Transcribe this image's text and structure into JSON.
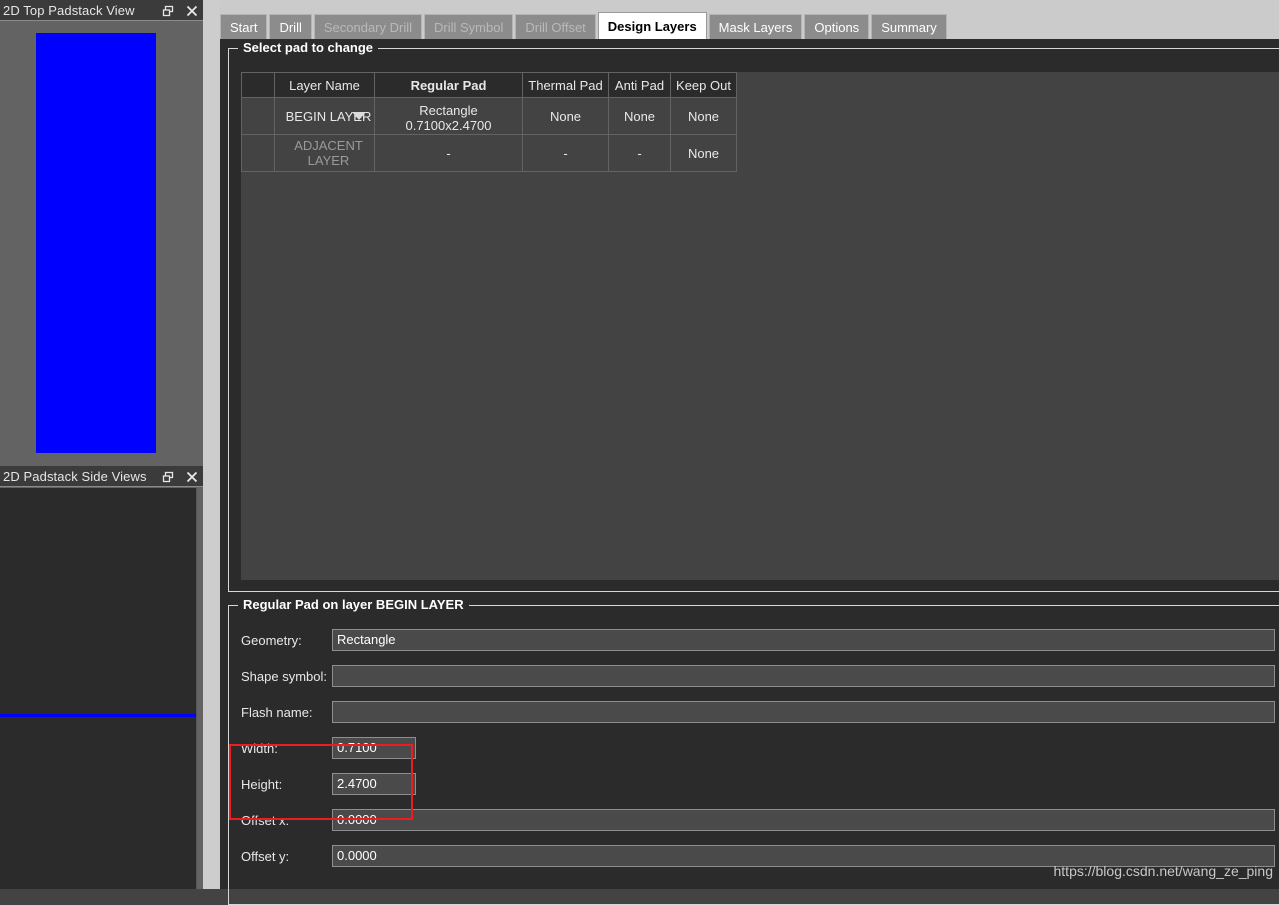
{
  "left_dock": {
    "top_view_panel": {
      "title": "2D Top Padstack View",
      "float_icon": "restore-icon",
      "close_icon": "close-icon",
      "pad_color": "#0000fe"
    },
    "side_view_panel": {
      "title": "2D Padstack Side Views",
      "float_icon": "restore-icon",
      "close_icon": "close-icon",
      "pad_color": "#0000fe"
    }
  },
  "tabs": [
    {
      "label": "Start",
      "state": "normal"
    },
    {
      "label": "Drill",
      "state": "normal"
    },
    {
      "label": "Secondary Drill",
      "state": "disabled"
    },
    {
      "label": "Drill Symbol",
      "state": "disabled"
    },
    {
      "label": "Drill Offset",
      "state": "disabled"
    },
    {
      "label": "Design Layers",
      "state": "active"
    },
    {
      "label": "Mask Layers",
      "state": "normal"
    },
    {
      "label": "Options",
      "state": "normal"
    },
    {
      "label": "Summary",
      "state": "normal"
    }
  ],
  "select_group": {
    "title": "Select pad to change",
    "columns": [
      "",
      "Layer Name",
      "Regular Pad",
      "Thermal Pad",
      "Anti Pad",
      "Keep Out"
    ],
    "rows": [
      {
        "selector": "",
        "layer_name": "BEGIN LAYER",
        "layer_is_combo": true,
        "regular_pad": "Rectangle 0.7100x2.4700",
        "regular_pad_selected": true,
        "thermal_pad": "None",
        "anti_pad": "None",
        "keep_out": "None"
      },
      {
        "selector": "",
        "layer_name": "ADJACENT LAYER",
        "layer_is_combo": false,
        "regular_pad": "-",
        "regular_pad_selected": false,
        "thermal_pad": "-",
        "anti_pad": "-",
        "keep_out": "None"
      }
    ]
  },
  "regular_pad_group": {
    "title": "Regular Pad on layer BEGIN LAYER",
    "fields": [
      {
        "label": "Geometry:",
        "value": "Rectangle",
        "size": "wide",
        "highlight": false
      },
      {
        "label": "Shape symbol:",
        "value": "",
        "size": "wide",
        "highlight": false
      },
      {
        "label": "Flash name:",
        "value": "",
        "size": "wide",
        "highlight": false
      },
      {
        "label": "Width:",
        "value": "0.7100",
        "size": "narrow",
        "highlight": true
      },
      {
        "label": "Height:",
        "value": "2.4700",
        "size": "narrow",
        "highlight": true
      },
      {
        "label": "Offset x:",
        "value": "0.0000",
        "size": "wide",
        "highlight": false
      },
      {
        "label": "Offset y:",
        "value": "0.0000",
        "size": "wide",
        "highlight": false
      }
    ]
  },
  "annotation": {
    "highlight_color": "#ee1c1c"
  },
  "watermark": {
    "text": "https://blog.csdn.net/wang_ze_ping"
  }
}
